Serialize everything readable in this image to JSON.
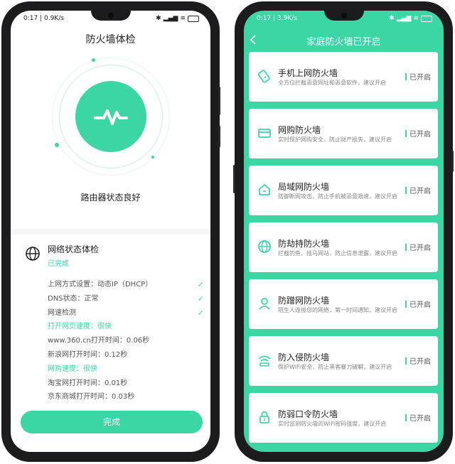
{
  "left": {
    "status": {
      "time": "0:17",
      "speed": "0.9K/s"
    },
    "title": "防火墙体检",
    "router_state": "路由器状态良好",
    "section_title": "网络状态体检",
    "section_status": "已完成",
    "items": [
      {
        "text": "上网方式设置：动态IP（DHCP）",
        "check": "✓"
      },
      {
        "text": "DNS状态：正常",
        "check": "✓"
      },
      {
        "text": "网速检测",
        "check": "✓"
      },
      {
        "text": "打开网页速度：很快",
        "check": ""
      },
      {
        "text": "www.360.cn打开时间：0.06秒",
        "check": ""
      },
      {
        "text": "新浪网打开时间：0.12秒",
        "check": ""
      },
      {
        "text": "网购速度：很快",
        "check": ""
      },
      {
        "text": "淘宝网打开时间：0.01秒",
        "check": ""
      },
      {
        "text": "京东商城打开时间：0.03秒",
        "check": ""
      }
    ],
    "done_button": "完成",
    "accent_color": "#3cd6a6"
  },
  "right": {
    "status": {
      "time": "0:17",
      "speed": "3.9K/s"
    },
    "back_icon": "chevron-left-icon",
    "title": "家庭防火墙已开启",
    "cards": [
      {
        "icon": "phone-shield-icon",
        "title": "手机上网防火墙",
        "desc": "全方位拦截恶意网址和恶意软件，建议开启",
        "state": "已开启"
      },
      {
        "icon": "card-icon",
        "title": "网购防火墙",
        "desc": "实时保护网购安全，防止财产损失，建议开启",
        "state": "已开启"
      },
      {
        "icon": "home-icon",
        "title": "局域网防火墙",
        "desc": "防御断网攻击，防止手机被恶意限速，建议开启",
        "state": "已开启"
      },
      {
        "icon": "globe-icon",
        "title": "防劫持防火墙",
        "desc": "拦截钓鱼、挂马网站，防止信息泄露，建议开启",
        "state": "已开启"
      },
      {
        "icon": "user-icon",
        "title": "防蹭网防火墙",
        "desc": "陌生人连接您的网络，第一时间通知，建议开启",
        "state": "已开启"
      },
      {
        "icon": "wifi-icon",
        "title": "防入侵防火墙",
        "desc": "保护WiFi安全，防止黑客暴力破解，建议开启",
        "state": "已开启"
      },
      {
        "icon": "lock-icon",
        "title": "防弱口令防火墙",
        "desc": "实时监测防火墙的WiFi密码强度，建议开启",
        "state": "已开启"
      }
    ],
    "background_color": "#3cd6a6"
  }
}
